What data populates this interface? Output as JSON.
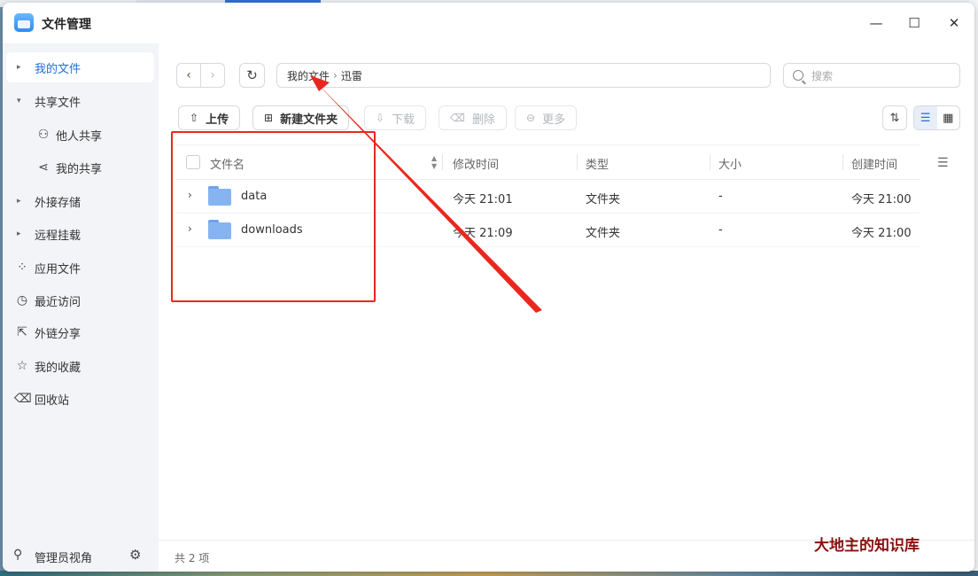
{
  "window": {
    "title": "文件管理",
    "controls": {
      "minimize": "—",
      "maximize": "☐",
      "close": "✕"
    }
  },
  "sidebar": {
    "items": [
      {
        "label": "我的文件",
        "icon": "caret-right-icon",
        "glyph": "▸",
        "active": true
      },
      {
        "label": "共享文件",
        "icon": "caret-down-icon",
        "glyph": "▾",
        "active": false
      },
      {
        "label": "他人共享",
        "icon": "users-icon",
        "glyph": "⚇",
        "active": false
      },
      {
        "label": "我的共享",
        "icon": "share-icon",
        "glyph": "⋖",
        "active": false
      },
      {
        "label": "外接存储",
        "icon": "caret-right-icon",
        "glyph": "▸",
        "active": false
      },
      {
        "label": "远程挂载",
        "icon": "caret-right-icon",
        "glyph": "▸",
        "active": false
      },
      {
        "label": "应用文件",
        "icon": "apps-icon",
        "glyph": "⁘",
        "active": false
      },
      {
        "label": "最近访问",
        "icon": "clock-icon",
        "glyph": "◷",
        "active": false
      },
      {
        "label": "外链分享",
        "icon": "external-link-icon",
        "glyph": "⇱",
        "active": false
      },
      {
        "label": "我的收藏",
        "icon": "star-icon",
        "glyph": "☆",
        "active": false
      },
      {
        "label": "回收站",
        "icon": "trash-icon",
        "glyph": "⌫",
        "active": false
      }
    ],
    "footer": {
      "label": "管理员视角",
      "icon": "admin-user-icon",
      "glyph": "⚲",
      "settings_icon": "gear-icon",
      "settings_glyph": "⚙"
    }
  },
  "nav": {
    "back_glyph": "‹",
    "forward_glyph": "›",
    "refresh_glyph": "↻"
  },
  "breadcrumb": {
    "root": "我的文件",
    "separator": "›",
    "current": "迅雷"
  },
  "search": {
    "placeholder": "搜索"
  },
  "toolbar": {
    "upload": "上传",
    "new_folder": "新建文件夹",
    "download": "下载",
    "delete": "删除",
    "more": "更多"
  },
  "view": {
    "sort_glyph": "⇅",
    "list_glyph": "☰",
    "grid_glyph": "▦",
    "mode": "list"
  },
  "table": {
    "columns": {
      "name": "文件名",
      "modified": "修改时间",
      "type": "类型",
      "size": "大小",
      "created": "创建时间"
    },
    "rows": [
      {
        "name": "data",
        "modified": "今天 21:01",
        "type": "文件夹",
        "size": "-",
        "created": "今天 21:00"
      },
      {
        "name": "downloads",
        "modified": "今天 21:09",
        "type": "文件夹",
        "size": "-",
        "created": "今天 21:00"
      }
    ]
  },
  "status": {
    "count_text": "共 2 项"
  },
  "watermark": "大地主的知识库",
  "colors": {
    "accent": "#1f6fd8",
    "annotation": "#e8281e",
    "folder": "#86b4f0"
  }
}
